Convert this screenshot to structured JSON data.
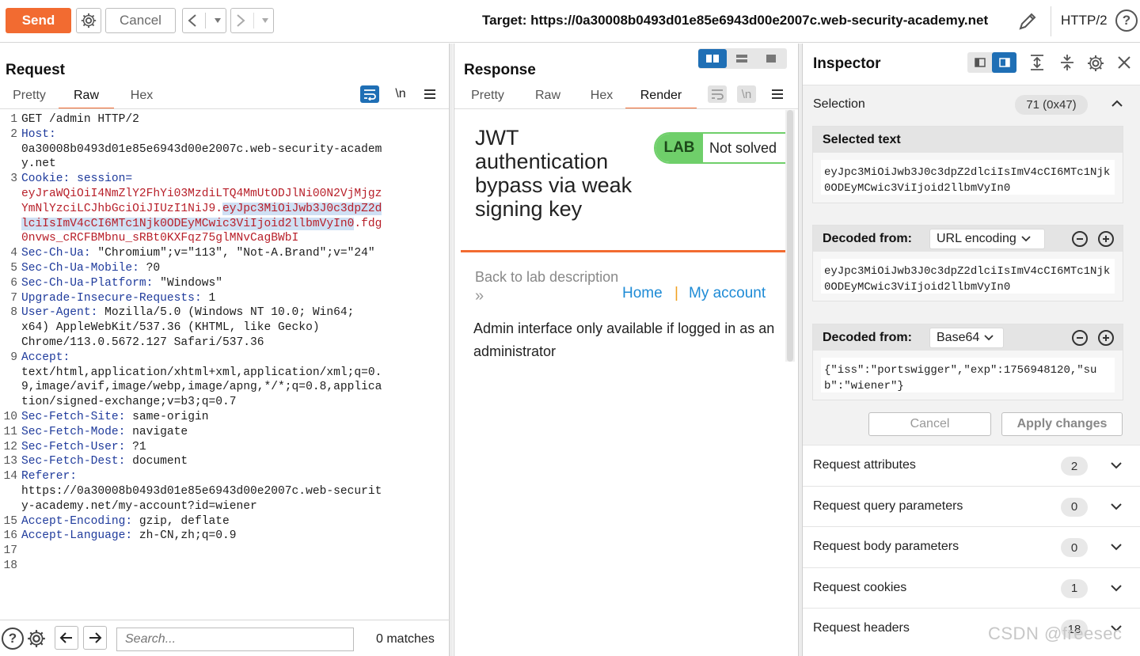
{
  "toolbar": {
    "send_label": "Send",
    "cancel_label": "Cancel",
    "target_label": "Target: https://0a30008b0493d01e85e6943d00e2007c.web-security-academy.net",
    "http_version": "HTTP/2",
    "help_label": "?"
  },
  "request": {
    "title": "Request",
    "tabs": [
      "Pretty",
      "Raw",
      "Hex"
    ],
    "active_tab": "Raw",
    "newline_label": "\\n",
    "line_numbers": [
      "1",
      "2",
      "",
      "",
      "3",
      "",
      "",
      "",
      "",
      "4",
      "5",
      "6",
      "7",
      "8",
      "",
      "",
      "9",
      "",
      "",
      "",
      "10",
      "11",
      "12",
      "13",
      "14",
      "",
      "",
      "15",
      "16",
      "17",
      "18"
    ],
    "lines": {
      "l1": "GET /admin HTTP/2",
      "l2k": "Host:",
      "l2v1": "0a30008b0493d01e85e6943d00e2007c.web-security-academ",
      "l2v2": "y.net",
      "l3k": "Cookie:",
      "l3n": " session=",
      "l3a": "eyJraWQiOiI4NmZlY2FhYi03MzdiLTQ4MmUtODJlNi00N2VjMjgz",
      "l3b1": "YmNlYzciLCJhbGciOiJIUzI1NiJ9.",
      "l3b2": "eyJpc3MiOiJwb3J0c3dpZ2d",
      "l3c1": "lciIsImV4cCI6MTc1Njk0ODEyMCwic3ViIjoid2llbmVyIn0",
      "l3c2": ".fdg",
      "l3d": "0nvws_cRCFBMbnu_sRBt0KXFqz75glMNvCagBWbI",
      "l4k": "Sec-Ch-Ua:",
      "l4v": " \"Chromium\";v=\"113\", \"Not-A.Brand\";v=\"24\"",
      "l5k": "Sec-Ch-Ua-Mobile:",
      "l5v": " ?0",
      "l6k": "Sec-Ch-Ua-Platform:",
      "l6v": " \"Windows\"",
      "l7k": "Upgrade-Insecure-Requests:",
      "l7v": " 1",
      "l8k": "User-Agent:",
      "l8v1": " Mozilla/5.0 (Windows NT 10.0; Win64;",
      "l8v2": "x64) AppleWebKit/537.36 (KHTML, like Gecko)",
      "l8v3": "Chrome/113.0.5672.127 Safari/537.36",
      "l9k": "Accept:",
      "l9v1": "text/html,application/xhtml+xml,application/xml;q=0.",
      "l9v2": "9,image/avif,image/webp,image/apng,*/*;q=0.8,applica",
      "l9v3": "tion/signed-exchange;v=b3;q=0.7",
      "l10k": "Sec-Fetch-Site:",
      "l10v": " same-origin",
      "l11k": "Sec-Fetch-Mode:",
      "l11v": " navigate",
      "l12k": "Sec-Fetch-User:",
      "l12v": " ?1",
      "l13k": "Sec-Fetch-Dest:",
      "l13v": " document",
      "l14k": "Referer:",
      "l14v1": "https://0a30008b0493d01e85e6943d00e2007c.web-securit",
      "l14v2": "y-academy.net/my-account?id=wiener",
      "l15k": "Accept-Encoding:",
      "l15v": " gzip, deflate",
      "l16k": "Accept-Language:",
      "l16v": " zh-CN,zh;q=0.9"
    },
    "search_placeholder": "Search...",
    "matches_label": "0 matches"
  },
  "response": {
    "title": "Response",
    "tabs": [
      "Pretty",
      "Raw",
      "Hex",
      "Render"
    ],
    "active_tab": "Render",
    "newline_label": "\\n",
    "render": {
      "page_title": "JWT authentication bypass via weak signing key",
      "lab_badge": "LAB",
      "lab_status": "Not solved",
      "back_link": "Back to lab description",
      "chevron": "»",
      "nav_home": "Home",
      "nav_sep": "|",
      "nav_account": "My account",
      "message": "Admin interface only available if logged in as an administrator"
    }
  },
  "inspector": {
    "title": "Inspector",
    "selection_label": "Selection",
    "selection_count": "71 (0x47)",
    "selected_text_label": "Selected text",
    "selected_text": "eyJpc3MiOiJwb3J0c3dpZ2dlciIsImV4cCI6MTc1Njk0ODEyMCwic3ViIjoid2llbmVyIn0",
    "decoded_1_label": "Decoded from:",
    "decoded_1_type": "URL encoding",
    "decoded_1_value": "eyJpc3MiOiJwb3J0c3dpZ2dlciIsImV4cCI6MTc1Njk0ODEyMCwic3ViIjoid2llbmVyIn0",
    "decoded_2_label": "Decoded from:",
    "decoded_2_type": "Base64",
    "decoded_2_value": "{\"iss\":\"portswigger\",\"exp\":1756948120,\"sub\":\"wiener\"}",
    "cancel_label": "Cancel",
    "apply_label": "Apply changes",
    "rows": [
      {
        "label": "Request attributes",
        "count": "2"
      },
      {
        "label": "Request query parameters",
        "count": "0"
      },
      {
        "label": "Request body parameters",
        "count": "0"
      },
      {
        "label": "Request cookies",
        "count": "1"
      },
      {
        "label": "Request headers",
        "count": "18"
      }
    ]
  },
  "watermark": "CSDN @freesec",
  "colors": {
    "accent": "#f26b31",
    "keyword": "#1f3b9c",
    "cookie": "#b8202a",
    "selection": "#cfe0f4",
    "lab_green": "#6fcf6a",
    "link_blue": "#1e8bd6",
    "layout_blue": "#1f6fb5"
  }
}
